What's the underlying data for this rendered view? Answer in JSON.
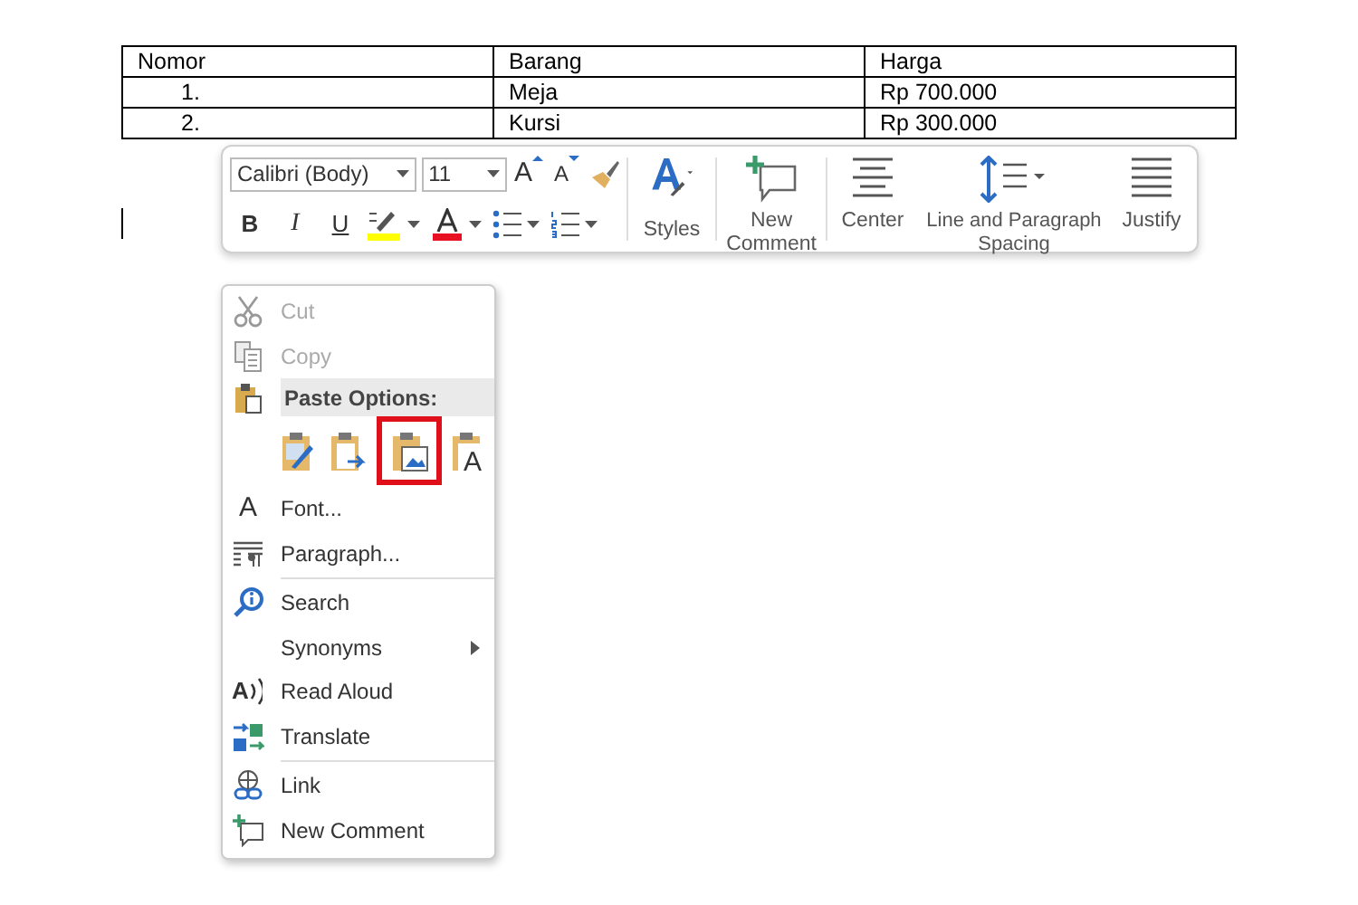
{
  "table": {
    "columns": [
      "Nomor",
      "Barang",
      "Harga"
    ],
    "rows": [
      [
        "1.",
        "Meja",
        "Rp 700.000"
      ],
      [
        "2.",
        "Kursi",
        "Rp 300.000"
      ]
    ]
  },
  "mini_toolbar": {
    "font": "Calibri (Body)",
    "size": "11",
    "grow_glyph": "A",
    "shrink_glyph": "A",
    "format_buttons": [
      {
        "kind": "bold",
        "glyph": "B"
      },
      {
        "kind": "italic",
        "glyph": "I"
      },
      {
        "kind": "underline",
        "glyph": "U"
      }
    ],
    "big_buttons": [
      {
        "kind": "styles",
        "label": "Styles"
      },
      {
        "kind": "comment",
        "label": "New Comment"
      },
      {
        "kind": "center",
        "label": "Center"
      },
      {
        "kind": "spacing",
        "label": "Line and Paragraph Spacing"
      },
      {
        "kind": "justify",
        "label": "Justify"
      }
    ]
  },
  "context_menu": [
    {
      "kind": "item",
      "label": "Cut",
      "disabled": true
    },
    {
      "kind": "item",
      "label": "Copy",
      "disabled": true
    },
    {
      "kind": "header",
      "label": "Paste Options:"
    },
    {
      "kind": "paste",
      "options": [
        {
          "highlighted": false
        },
        {
          "highlighted": false
        },
        {
          "highlighted": true
        },
        {
          "highlighted": false,
          "glyph": "A"
        }
      ]
    },
    {
      "kind": "item",
      "label": "Font...",
      "disabled": false,
      "glyph": "A"
    },
    {
      "kind": "item",
      "label": "Paragraph...",
      "disabled": false
    },
    {
      "kind": "separator"
    },
    {
      "kind": "item",
      "label": "Search",
      "disabled": false
    },
    {
      "kind": "item",
      "label": "Synonyms",
      "disabled": false,
      "submenu": true
    },
    {
      "kind": "item",
      "label": "Read Aloud",
      "disabled": false,
      "glyph": "A"
    },
    {
      "kind": "item",
      "label": "Translate",
      "disabled": false
    },
    {
      "kind": "separator"
    },
    {
      "kind": "item",
      "label": "Link",
      "disabled": false
    },
    {
      "kind": "item",
      "label": "New Comment",
      "disabled": false
    }
  ]
}
